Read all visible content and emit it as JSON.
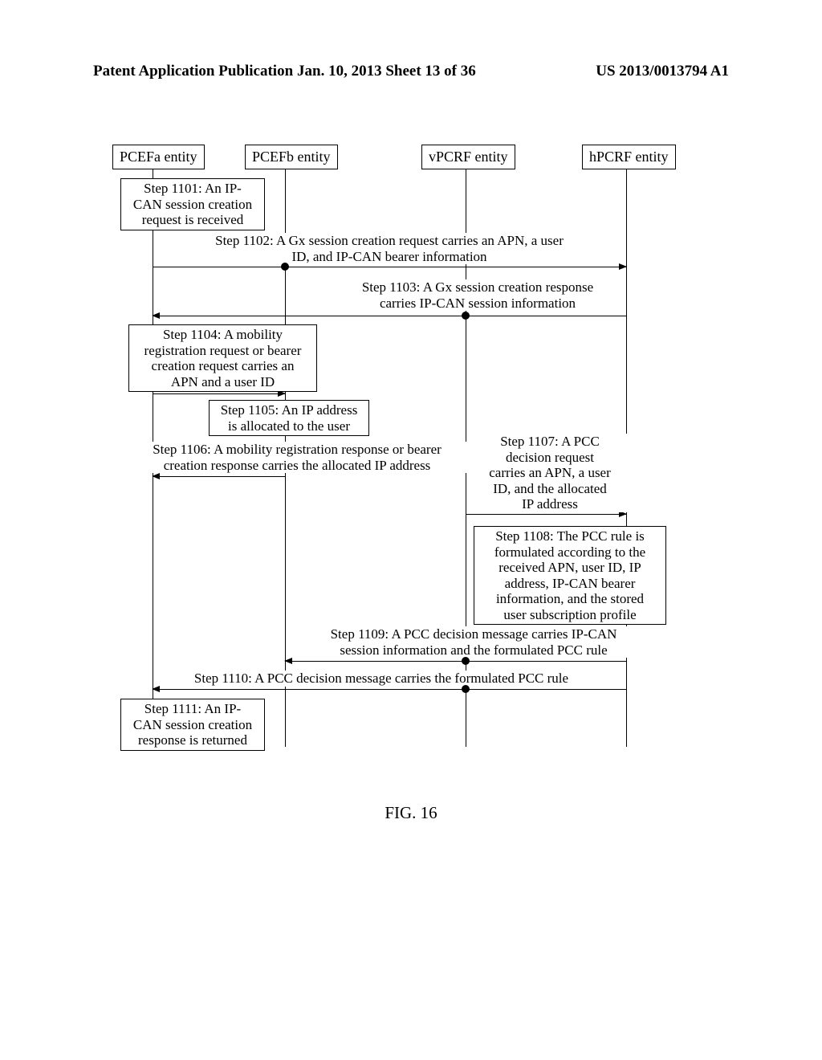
{
  "header": {
    "left": "Patent Application Publication",
    "center": "Jan. 10, 2013  Sheet 13 of 36",
    "right": "US 2013/0013794 A1"
  },
  "entities": {
    "pcefa": "PCEFa entity",
    "pcefb": "PCEFb entity",
    "vpcrf": "vPCRF entity",
    "hpcrf": "hPCRF entity"
  },
  "steps": {
    "s1101": "Step 1101: An IP-\nCAN session creation\nrequest is received",
    "s1102": "Step 1102: A Gx session creation request carries an APN, a user\nID, and IP-CAN bearer information",
    "s1103": "Step 1103: A Gx session creation response\ncarries IP-CAN session information",
    "s1104": "Step 1104: A mobility\nregistration request or bearer\ncreation request carries an\nAPN and a user ID",
    "s1105": "Step 1105: An IP address\nis allocated to the user",
    "s1106": "Step 1106: A mobility registration response or bearer\ncreation response carries the allocated IP address",
    "s1107": "Step 1107: A PCC\ndecision request\ncarries an APN, a user\nID, and the allocated\nIP address",
    "s1108": "Step 1108: The PCC rule is\nformulated according to the\nreceived APN, user ID, IP\naddress, IP-CAN bearer\ninformation, and the stored\nuser subscription profile",
    "s1109": "Step 1109: A PCC decision message carries IP-CAN\nsession information and the formulated PCC rule",
    "s1110": "Step 1110: A PCC decision message carries the formulated PCC rule",
    "s1111": "Step 1111: An IP-\nCAN session creation\nresponse is returned"
  },
  "figure": {
    "caption": "FIG. 16"
  }
}
